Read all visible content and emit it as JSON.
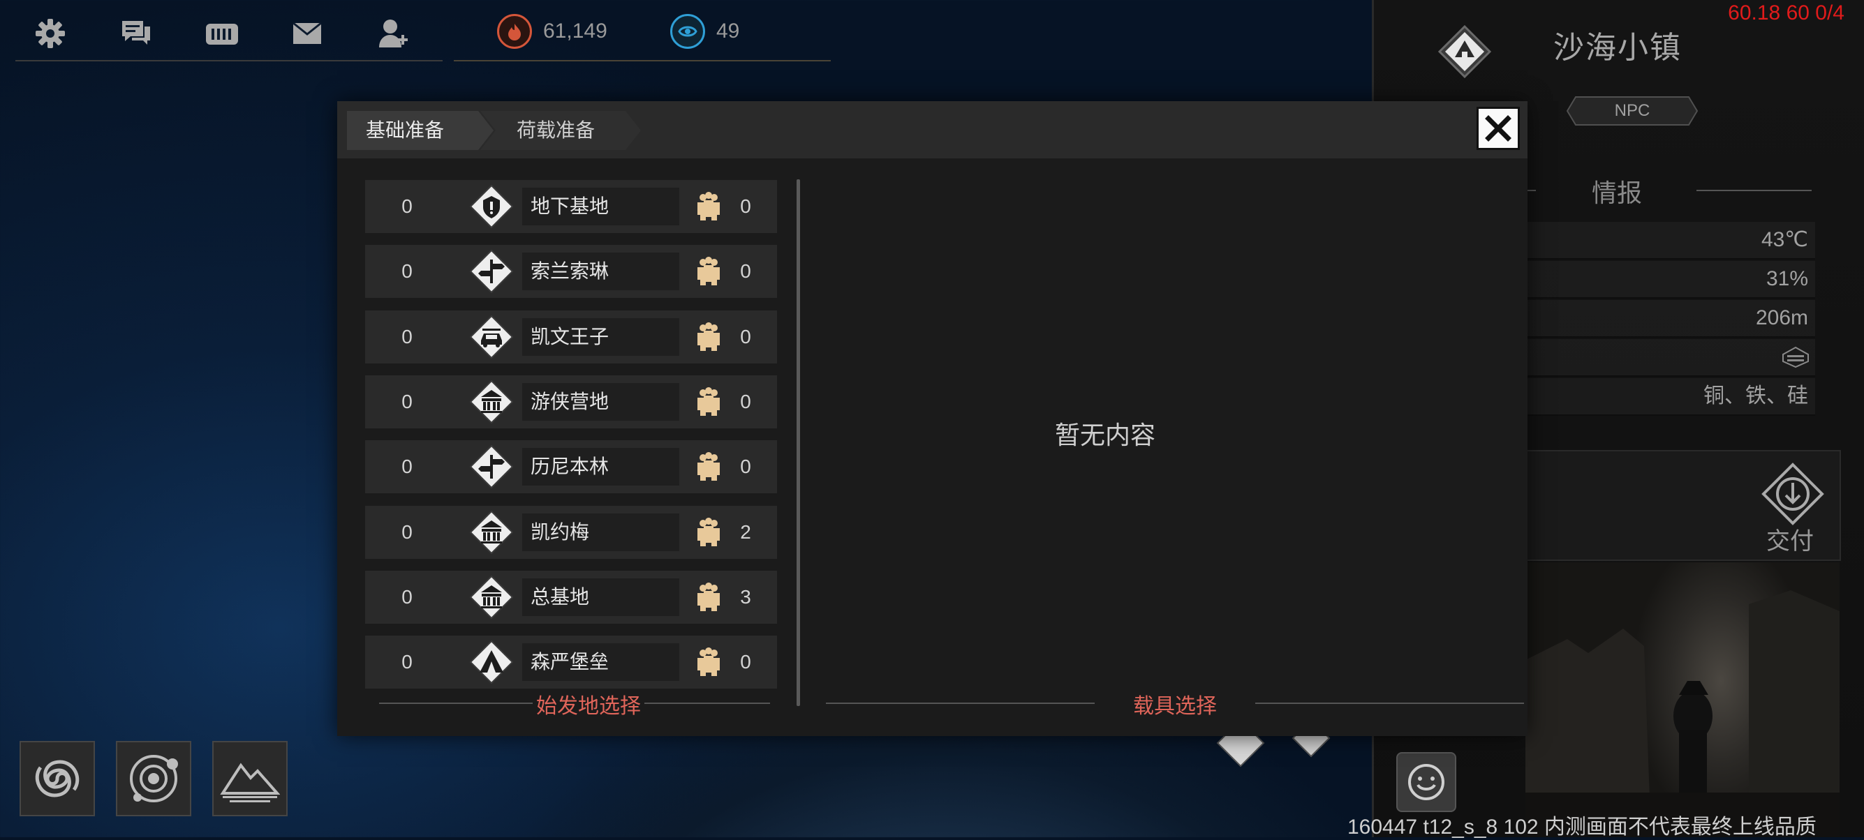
{
  "topbar": {
    "icons": [
      "gear-icon",
      "chat-icon",
      "mailbox-icon",
      "mail-icon",
      "friend-icon"
    ],
    "resource1": {
      "value": "61,149",
      "icon": "fuel-icon",
      "color": "#d4563a"
    },
    "resource2": {
      "value": "49",
      "icon": "token-icon",
      "color": "#2f9fd6"
    }
  },
  "fps_text": "60.18 60 0/4",
  "location": {
    "name": "沙海小镇",
    "tag": "NPC",
    "intel_title": "情报",
    "info": [
      "43℃",
      "31%",
      "206m",
      "",
      "铜、铁、硅"
    ],
    "deliver_label": "交付"
  },
  "dialog": {
    "tabs": [
      "基础准备",
      "荷载准备"
    ],
    "origins": [
      {
        "name": "地下基地",
        "left": "0",
        "right": "0",
        "icon": "shield-icon"
      },
      {
        "name": "索兰索琳",
        "left": "0",
        "right": "0",
        "icon": "signpost-icon"
      },
      {
        "name": "凯文王子",
        "left": "0",
        "right": "0",
        "icon": "car-icon"
      },
      {
        "name": "游侠营地",
        "left": "0",
        "right": "0",
        "icon": "building-icon"
      },
      {
        "name": "历尼本林",
        "left": "0",
        "right": "0",
        "icon": "signpost-icon"
      },
      {
        "name": "凯约梅",
        "left": "0",
        "right": "2",
        "icon": "building-icon"
      },
      {
        "name": "总基地",
        "left": "0",
        "right": "3",
        "icon": "building-icon"
      },
      {
        "name": "森严堡垒",
        "left": "0",
        "right": "0",
        "icon": "tent-icon"
      }
    ],
    "empty_text": "暂无内容",
    "origin_select_label": "始发地选择",
    "vehicle_select_label": "载具选择"
  },
  "bottom_buttons": [
    "galaxy-icon",
    "orbit-icon",
    "mountain-icon"
  ],
  "build_text": "160447 t12_s_8 102  内测画面不代表最终上线品质",
  "colors": {
    "accent_red": "#e0655a",
    "fps_red": "#e11b1b",
    "population": "#e8c99a"
  }
}
